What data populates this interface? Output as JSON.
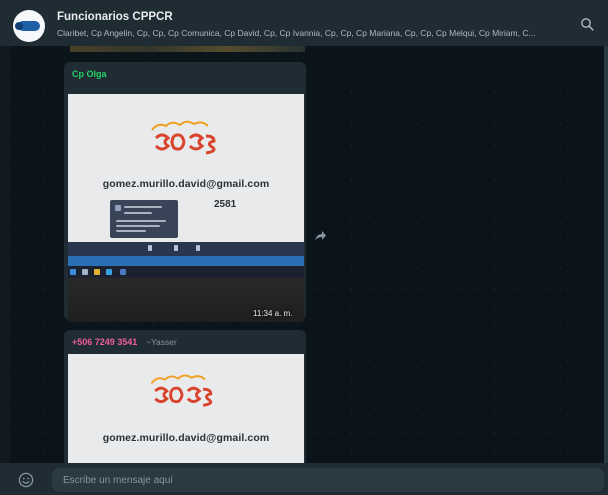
{
  "header": {
    "title": "Funcionarios CPPCR",
    "members": "Claribet, Cp Angelin, Cp, Cp, Cp Comunica, Cp David, Cp, Cp Ivannia, Cp, Cp, Cp Mariana, Cp, Cp, Cp Melqui, Cp Miriam, C..."
  },
  "messages": [
    {
      "sender": "Cp Olga",
      "image_text": {
        "email": "gomez.murillo.david@gmail.com",
        "number_partial": "2581"
      },
      "time": "11:34 a. m."
    },
    {
      "sender": "+506 7249 3541",
      "push_name": "~Yasser",
      "image_text": {
        "email": "gomez.murillo.david@gmail.com"
      }
    }
  ],
  "composer": {
    "placeholder": "Escribe un mensaje aquí"
  },
  "colors": {
    "header_bg": "#202c33",
    "chat_bg": "#0b141a",
    "bubble_bg": "#202c33",
    "sender_green": "#25d366",
    "sender_pink": "#f15c9a",
    "logo_red": "#d9442c",
    "logo_orange": "#f0a020"
  },
  "icons": {
    "group_avatar": "cppcr-logo-icon",
    "search": "search-icon",
    "forward": "forward-icon",
    "emoji": "emoji-icon"
  }
}
